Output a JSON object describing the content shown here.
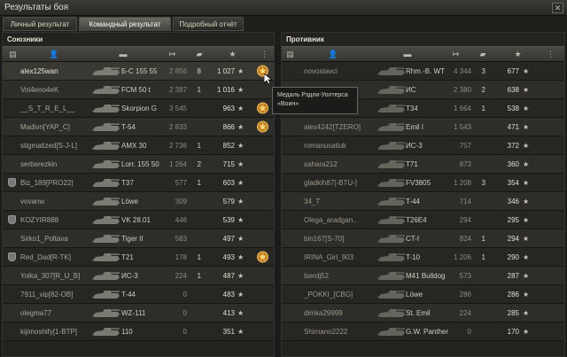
{
  "window": {
    "title": "Результаты боя",
    "close": "✕"
  },
  "tabs": [
    {
      "label": "Личный результат",
      "active": false
    },
    {
      "label": "Командный результат",
      "active": true
    },
    {
      "label": "Подробный отчёт",
      "active": false
    }
  ],
  "colors": {
    "allies_self": "#e9e6d8",
    "allies_dim": "#a8a597",
    "enemy": "#9b978a",
    "dead": "#8c6a5e",
    "gold": "#e2a43a"
  },
  "allies": {
    "title": "Союзники",
    "players": [
      {
        "name": "alex125wan",
        "vehicle": "Б-С 155 55",
        "damage": "2 856",
        "kills": "8",
        "xp": "1 027",
        "medal": true,
        "self": true
      },
      {
        "name": "Vol4eno4eK",
        "vehicle": "FCM 50 t",
        "damage": "2 387",
        "kills": "1",
        "xp": "1 016",
        "medal": false
      },
      {
        "name": "__S_T_R_E_L__",
        "vehicle": "Skorpion G",
        "damage": "3 545",
        "kills": "",
        "xp": "963",
        "medal": true
      },
      {
        "name": "Madivn[YAP_C]",
        "vehicle": "T-54",
        "damage": "2 833",
        "kills": "",
        "xp": "866",
        "medal": true
      },
      {
        "name": "stigmatized[S-J-L]",
        "vehicle": "AMX 30",
        "damage": "2 736",
        "kills": "1",
        "xp": "852",
        "medal": false
      },
      {
        "name": "serberezkin",
        "vehicle": "Lorr. 155 50",
        "damage": "1 264",
        "kills": "2",
        "xp": "715",
        "medal": false
      },
      {
        "name": "Biz_189[PRO22]",
        "vehicle": "T37",
        "damage": "577",
        "kills": "1",
        "xp": "603",
        "medal": false,
        "badge": true
      },
      {
        "name": "vovanw",
        "vehicle": "Löwe",
        "damage": "309",
        "kills": "",
        "xp": "579",
        "medal": false
      },
      {
        "name": "KOZYIR888",
        "vehicle": "VK 28.01",
        "damage": "446",
        "kills": "",
        "xp": "539",
        "medal": false,
        "badge": true
      },
      {
        "name": "Sirko1_Poltava",
        "vehicle": "Tiger II",
        "damage": "583",
        "kills": "",
        "xp": "497",
        "medal": false
      },
      {
        "name": "Red_Dad[R-TK]",
        "vehicle": "T21",
        "damage": "178",
        "kills": "1",
        "xp": "493",
        "medal": true,
        "badge": true
      },
      {
        "name": "Yolka_307[R_U_B]",
        "vehicle": "ИС-3",
        "damage": "224",
        "kills": "1",
        "xp": "487",
        "medal": false
      },
      {
        "name": "7911_vip[82-OB]",
        "vehicle": "T-44",
        "damage": "0",
        "kills": "",
        "xp": "483",
        "medal": false
      },
      {
        "name": "olegma77",
        "vehicle": "WZ-111",
        "damage": "0",
        "kills": "",
        "xp": "413",
        "medal": false
      },
      {
        "name": "kijimoshify[1-BTP]",
        "vehicle": "110",
        "damage": "0",
        "kills": "",
        "xp": "351",
        "medal": false
      }
    ]
  },
  "enemies": {
    "title": "Противник",
    "players": [
      {
        "name": "novostavci",
        "vehicle": "Rhm.-B. WT",
        "damage": "4 344",
        "kills": "3",
        "xp": "677"
      },
      {
        "name": "",
        "vehicle": "ИС",
        "damage": "2 380",
        "kills": "2",
        "xp": "638"
      },
      {
        "name": "",
        "vehicle": "T34",
        "damage": "1 664",
        "kills": "1",
        "xp": "538"
      },
      {
        "name": "alex4242[TZERO]",
        "vehicle": "Emil I",
        "damage": "1 543",
        "kills": "",
        "xp": "471"
      },
      {
        "name": "romanusatiuk",
        "vehicle": "ИС-3",
        "damage": "757",
        "kills": "",
        "xp": "372"
      },
      {
        "name": "sahara212",
        "vehicle": "T71",
        "damage": "873",
        "kills": "",
        "xp": "360"
      },
      {
        "name": "gladkih87[-BTU-]",
        "vehicle": "FV3805",
        "damage": "1 208",
        "kills": "3",
        "xp": "354"
      },
      {
        "name": "34_T",
        "vehicle": "T-44",
        "damage": "714",
        "kills": "",
        "xp": "346"
      },
      {
        "name": "Olega_aradgan..",
        "vehicle": "T26E4",
        "damage": "294",
        "kills": "",
        "xp": "295"
      },
      {
        "name": "bin167[S-70]",
        "vehicle": "CT-I",
        "damage": "824",
        "kills": "1",
        "xp": "294"
      },
      {
        "name": "IRINA_Girl_903",
        "vehicle": "T-10",
        "damage": "1 206",
        "kills": "1",
        "xp": "290"
      },
      {
        "name": "lserdj52",
        "vehicle": "M41 Bulldog",
        "damage": "573",
        "kills": "",
        "xp": "287"
      },
      {
        "name": "_POKKI_[CBG]",
        "vehicle": "Löwe",
        "damage": "286",
        "kills": "",
        "xp": "286"
      },
      {
        "name": "dimka29999",
        "vehicle": "St. Emil",
        "damage": "224",
        "kills": "",
        "xp": "285"
      },
      {
        "name": "Shimano2222",
        "vehicle": "G.W. Panther",
        "damage": "0",
        "kills": "",
        "xp": "170"
      }
    ]
  },
  "tooltip": {
    "line1": "Медаль Рэдли-Уолтерса",
    "line2": "«Воин»"
  },
  "icons": {
    "header": [
      "squad-icon",
      "player-icon",
      "tank-icon",
      "damage-icon",
      "kills-icon",
      "xp-icon",
      "medal-icon"
    ],
    "star": "★"
  }
}
